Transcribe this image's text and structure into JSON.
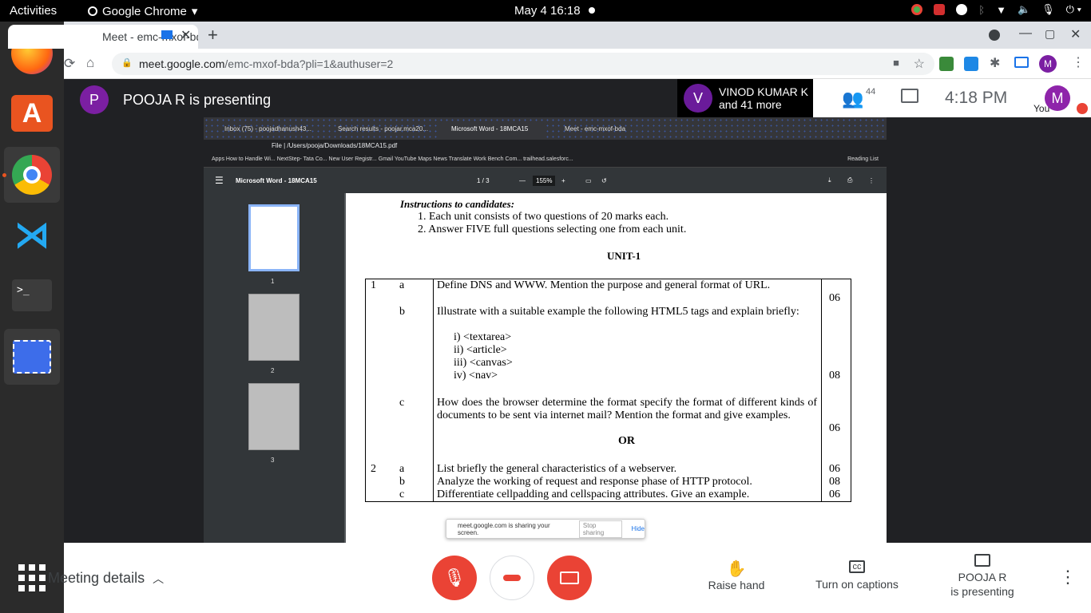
{
  "topbar": {
    "activities": "Activities",
    "app": "Google Chrome",
    "clock": "May 4  16:18"
  },
  "browser": {
    "tab_title": "Meet - emc-mxof-bda",
    "url_host": "meet.google.com",
    "url_path": "/emc-mxof-bda?pli=1&authuser=2"
  },
  "meet": {
    "presenter_initial": "P",
    "presenter_text": "POOJA R is presenting",
    "viewer_initial": "V",
    "viewer_name": "VINOD KUMAR K",
    "viewer_more": "and 41 more",
    "participants": "44",
    "time": "4:18 PM",
    "you_label": "You",
    "you_initial": "M"
  },
  "shared": {
    "tabs": [
      "Inbox (75) - poojadhanush43...",
      "Search results - poojar.mca20...",
      "Microsoft Word - 18MCA15",
      "Meet - emc-mxof-bda"
    ],
    "address": "File  |  /Users/pooja/Downloads/18MCA15.pdf",
    "bookmarks": "Apps   How to Handle Wi...   NextStep- Tata Co...   New User Registr...   Gmail   YouTube   Maps   News   Translate   Work Bench Com...   trailhead.salesforc...",
    "reading_list": "Reading List",
    "pdf_title": "Microsoft Word - 18MCA15",
    "page_indicator": "1 / 3",
    "zoom": "155%",
    "thumb_labels": [
      "1",
      "2",
      "3"
    ],
    "instructions": "Instructions to candidates:",
    "inst1": "1.  Each unit consists of two questions of 20 marks each.",
    "inst2": "2.  Answer FIVE full questions selecting one from each unit.",
    "unit": "UNIT-1",
    "q1": "1",
    "q1a_letter": "a",
    "q1a": "Define DNS and WWW. Mention the purpose and general format of URL.",
    "q1a_marks": "06",
    "q1b_letter": "b",
    "q1b": "Illustrate with a suitable example the following HTML5 tags and explain briefly:",
    "q1b_items": [
      "i)   <textarea>",
      "ii)   <article>",
      "iii)   <canvas>",
      "iv)   <nav>"
    ],
    "q1b_marks": "08",
    "q1c_letter": "c",
    "q1c": "How does the browser determine the format specify the format of different kinds of documents to be sent via internet mail? Mention the format and give examples.",
    "q1c_marks": "06",
    "or": "OR",
    "q2": "2",
    "q2a": "List briefly the general characteristics of a webserver.",
    "q2b": "Analyze the working of request and response phase of HTTP protocol.",
    "q2c": "Differentiate cellpadding and cellspacing attributes. Give an example.",
    "q2_marks": [
      "06",
      "08",
      "06"
    ],
    "q2_letters": [
      "a",
      "b",
      "c"
    ],
    "sharing_text": "meet.google.com is sharing your screen.",
    "stop_sharing": "Stop sharing",
    "hide": "Hide"
  },
  "bottom": {
    "meeting_details": "Meeting details",
    "raise_hand": "Raise hand",
    "captions": "Turn on captions",
    "presenting_1": "POOJA R",
    "presenting_2": "is presenting"
  },
  "colors": {
    "purple": "#7b1fa2",
    "red": "#ea4335",
    "navy": "#1a237e"
  }
}
